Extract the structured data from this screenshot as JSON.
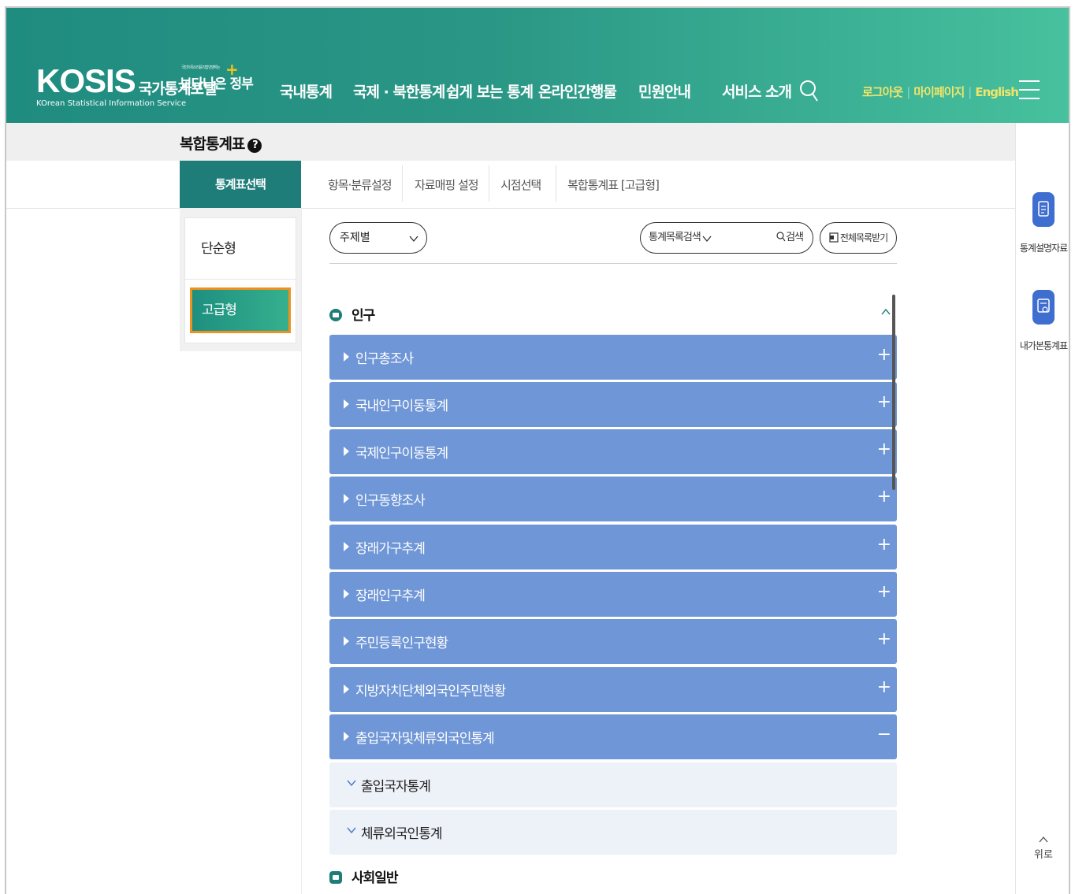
{
  "header": {
    "logo": "KOSIS",
    "logo_kr": "국가통계포털",
    "logo_sub": "KOrean Statistical Information Service",
    "gov_tiny": "국민의 목소리를 직접 반영하는",
    "gov_text": "보다나은 정부",
    "nav": [
      "국내통계",
      "국제 · 북한통계",
      "쉽게 보는 통계",
      "온라인간행물",
      "민원안내",
      "서비스 소개"
    ],
    "util": [
      "로그아웃",
      "마이페이지",
      "English"
    ]
  },
  "page": {
    "title": "복합통계표",
    "help": "?"
  },
  "tabs": {
    "active": "통계표선택",
    "items": [
      "항목·분류설정",
      "자료매핑 설정",
      "시점선택",
      "복합통계표 [고급형]"
    ]
  },
  "left": {
    "simple": "단순형",
    "advanced": "고급형"
  },
  "controls": {
    "subject_select": "주제별",
    "search_scope": "통계목록검색",
    "search_button": "검색",
    "download_button": "전체목록받기"
  },
  "tree": {
    "category1": "인구",
    "items": [
      {
        "label": "인구총조사",
        "state": "+"
      },
      {
        "label": "국내인구이동통계",
        "state": "+"
      },
      {
        "label": "국제인구이동통계",
        "state": "+"
      },
      {
        "label": "인구동향조사",
        "state": "+"
      },
      {
        "label": "장래가구추계",
        "state": "+"
      },
      {
        "label": "장래인구추계",
        "state": "+"
      },
      {
        "label": "주민등록인구현황",
        "state": "+"
      },
      {
        "label": "지방자치단체외국인주민현황",
        "state": "+"
      },
      {
        "label": "출입국자및체류외국인통계",
        "state": "−"
      }
    ],
    "subitems": [
      "출입국자통계",
      "체류외국인통계"
    ],
    "category2": "사회일반"
  },
  "rightbar": {
    "item1": "통계설명자료",
    "item2": "내가본통계표",
    "top": "위로"
  },
  "colors": {
    "header_start": "#1f8c80",
    "header_end": "#47c19e",
    "active_tab": "#1e7d79",
    "row_bg": "#6f96d6",
    "subrow_bg": "#edf1f8",
    "highlight_border": "#f0901e",
    "quick_icon": "#3e6ed0"
  }
}
